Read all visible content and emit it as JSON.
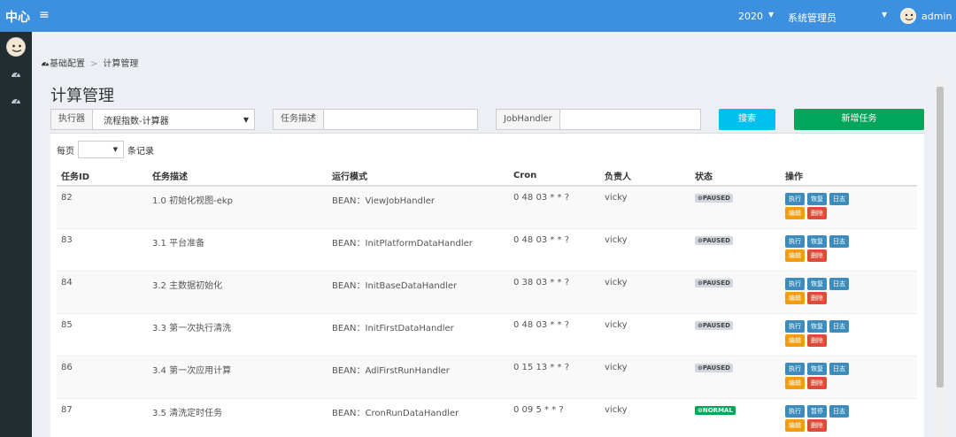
{
  "topbar": {
    "brand": "中心",
    "menu_icon": "≡",
    "year": "2020",
    "role": "系统管理员",
    "username": "admin",
    "caret": "▼"
  },
  "breadcrumb": {
    "home": "基础配置",
    "current": "计算管理"
  },
  "page_title": "计算管理",
  "filters": {
    "executor_label": "执行器",
    "executor_value": "流程指数-计算器",
    "desc_label": "任务描述",
    "desc_value": "",
    "handler_label": "JobHandler",
    "handler_value": "",
    "search_label": "搜索",
    "add_label": "新增任务"
  },
  "pagesize": {
    "prefix": "每页",
    "suffix": "条记录",
    "value": ""
  },
  "table": {
    "headers": [
      "任务ID",
      "任务描述",
      "运行模式",
      "Cron",
      "负责人",
      "状态",
      "操作"
    ],
    "rows": [
      {
        "id": "82",
        "desc": "1.0 初始化视图-ekp",
        "mode": "BEAN：ViewJobHandler",
        "cron": "0 48 03 * * ?",
        "owner": "vicky",
        "status": "⊙PAUSED",
        "state": "paused",
        "toggle": "恢复"
      },
      {
        "id": "83",
        "desc": "3.1 平台准备",
        "mode": "BEAN：InitPlatformDataHandler",
        "cron": "0 48 03 * * ?",
        "owner": "vicky",
        "status": "⊙PAUSED",
        "state": "paused",
        "toggle": "恢复"
      },
      {
        "id": "84",
        "desc": "3.2 主数据初始化",
        "mode": "BEAN：InitBaseDataHandler",
        "cron": "0 38 03 * * ?",
        "owner": "vicky",
        "status": "⊙PAUSED",
        "state": "paused",
        "toggle": "恢复"
      },
      {
        "id": "85",
        "desc": "3.3 第一次执行清洗",
        "mode": "BEAN：InitFirstDataHandler",
        "cron": "0 48 03 * * ?",
        "owner": "vicky",
        "status": "⊙PAUSED",
        "state": "paused",
        "toggle": "恢复"
      },
      {
        "id": "86",
        "desc": "3.4 第一次应用计算",
        "mode": "BEAN：AdlFirstRunHandler",
        "cron": "0 15 13 * * ?",
        "owner": "vicky",
        "status": "⊙PAUSED",
        "state": "paused",
        "toggle": "恢复"
      },
      {
        "id": "87",
        "desc": "3.5 清洗定时任务",
        "mode": "BEAN：CronRunDataHandler",
        "cron": "0 09 5 * * ?",
        "owner": "vicky",
        "status": "⊙NORMAL",
        "state": "normal",
        "toggle": "暂停"
      }
    ],
    "actions": {
      "run": "执行",
      "log": "日志",
      "edit": "编辑",
      "delete": "删除"
    }
  },
  "colors": {
    "topbar": "#3d8fe0",
    "sidebar": "#222d32",
    "search_btn": "#00c0ef",
    "add_btn": "#00a65a",
    "paused": "#d2d6de",
    "normal": "#00a65a",
    "btn_primary": "#3c8dbc",
    "btn_warning": "#f39c12",
    "btn_danger": "#dd4b39"
  }
}
